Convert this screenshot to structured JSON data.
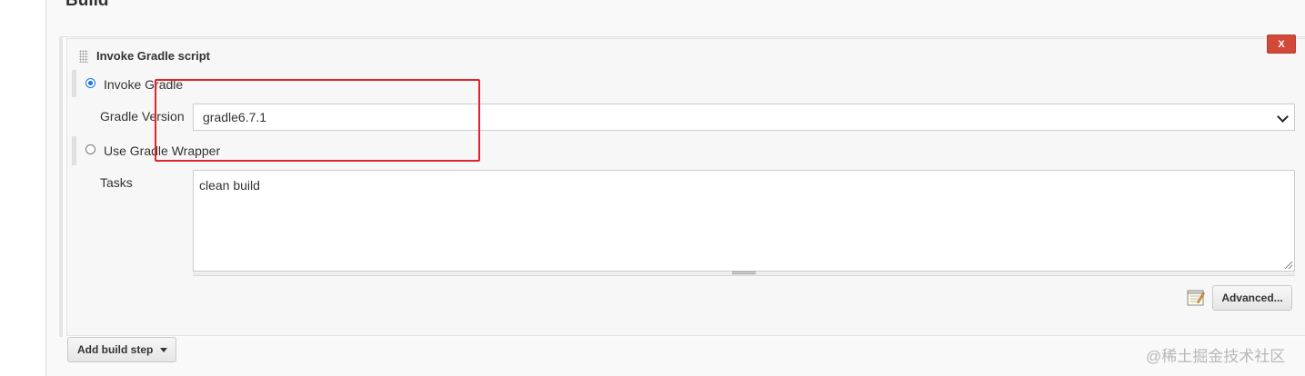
{
  "section": {
    "title": "Build"
  },
  "step": {
    "title": "Invoke Gradle script",
    "delete_label": "X"
  },
  "options": {
    "invoke_gradle": {
      "label": "Invoke Gradle",
      "selected": true
    },
    "use_wrapper": {
      "label": "Use Gradle Wrapper",
      "selected": false
    }
  },
  "gradle_version": {
    "label": "Gradle Version",
    "value": "gradle6.7.1"
  },
  "tasks": {
    "label": "Tasks",
    "value": "clean build"
  },
  "buttons": {
    "advanced": "Advanced...",
    "add_build_step": "Add build step"
  },
  "watermark": "@稀土掘金技术社区",
  "colors": {
    "delete_button": "#d24939",
    "highlight": "#e0242a",
    "radio_accent": "#1a73e8"
  },
  "icons": {
    "drag": "drag-handle-icon",
    "notepad": "notepad-icon",
    "dropdown": "chevron-down-icon",
    "add_caret": "caret-down-icon"
  }
}
